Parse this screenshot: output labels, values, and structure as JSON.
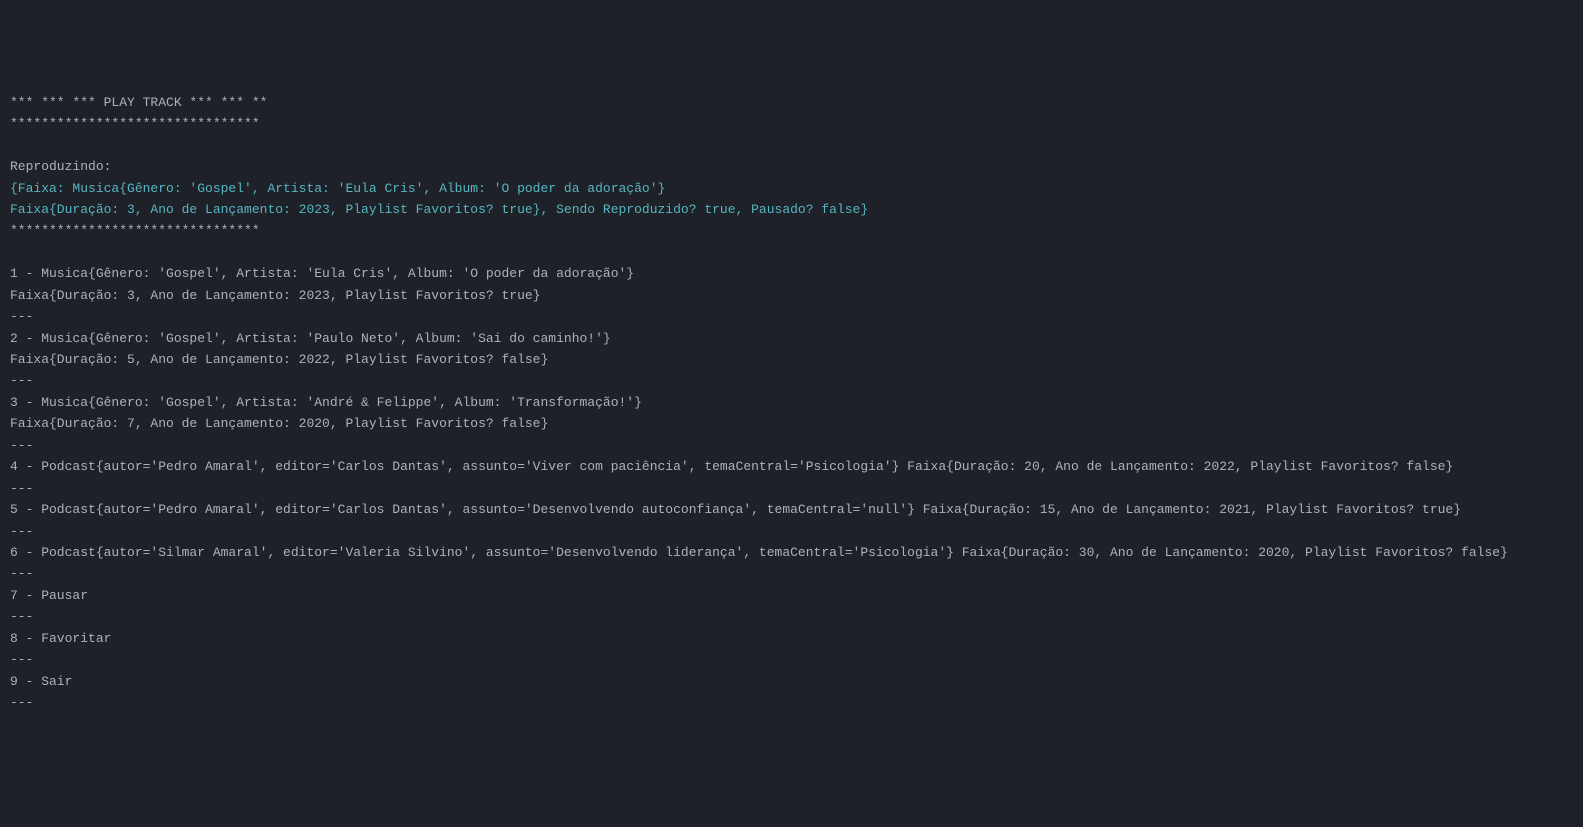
{
  "header": {
    "title_line": "*** *** *** PLAY TRACK *** *** **",
    "separator": "********************************"
  },
  "playing": {
    "label": "Reproduzindo:",
    "line1": "{Faixa: Musica{Gênero: 'Gospel', Artista: 'Eula Cris', Album: 'O poder da adoração'}",
    "line2": "Faixa{Duração: 3, Ano de Lançamento: 2023, Playlist Favoritos? true}, Sendo Reproduzido? true, Pausado? false}",
    "separator": "********************************"
  },
  "divider": "---",
  "tracks": [
    {
      "line1": "1 - Musica{Gênero: 'Gospel', Artista: 'Eula Cris', Album: 'O poder da adoração'}",
      "line2": "Faixa{Duração: 3, Ano de Lançamento: 2023, Playlist Favoritos? true}"
    },
    {
      "line1": "2 - Musica{Gênero: 'Gospel', Artista: 'Paulo Neto', Album: 'Sai do caminho!'}",
      "line2": "Faixa{Duração: 5, Ano de Lançamento: 2022, Playlist Favoritos? false}"
    },
    {
      "line1": "3 - Musica{Gênero: 'Gospel', Artista: 'André & Felippe', Album: 'Transformação!'}",
      "line2": "Faixa{Duração: 7, Ano de Lançamento: 2020, Playlist Favoritos? false}"
    },
    {
      "line1": "4 - Podcast{autor='Pedro Amaral', editor='Carlos Dantas', assunto='Viver com paciência', temaCentral='Psicologia'} Faixa{Duração: 20, Ano de Lançamento: 2022, Playlist Favoritos? false}",
      "line2": ""
    },
    {
      "line1": "5 - Podcast{autor='Pedro Amaral', editor='Carlos Dantas', assunto='Desenvolvendo autoconfiança', temaCentral='null'} Faixa{Duração: 15, Ano de Lançamento: 2021, Playlist Favoritos? true}",
      "line2": ""
    },
    {
      "line1": "6 - Podcast{autor='Silmar Amaral', editor='Valeria Silvino', assunto='Desenvolvendo liderança', temaCentral='Psicologia'} Faixa{Duração: 30, Ano de Lançamento: 2020, Playlist Favoritos? false}",
      "line2": ""
    }
  ],
  "options": [
    {
      "label": "7 - Pausar"
    },
    {
      "label": "8 - Favoritar"
    },
    {
      "label": "9 - Sair"
    }
  ]
}
